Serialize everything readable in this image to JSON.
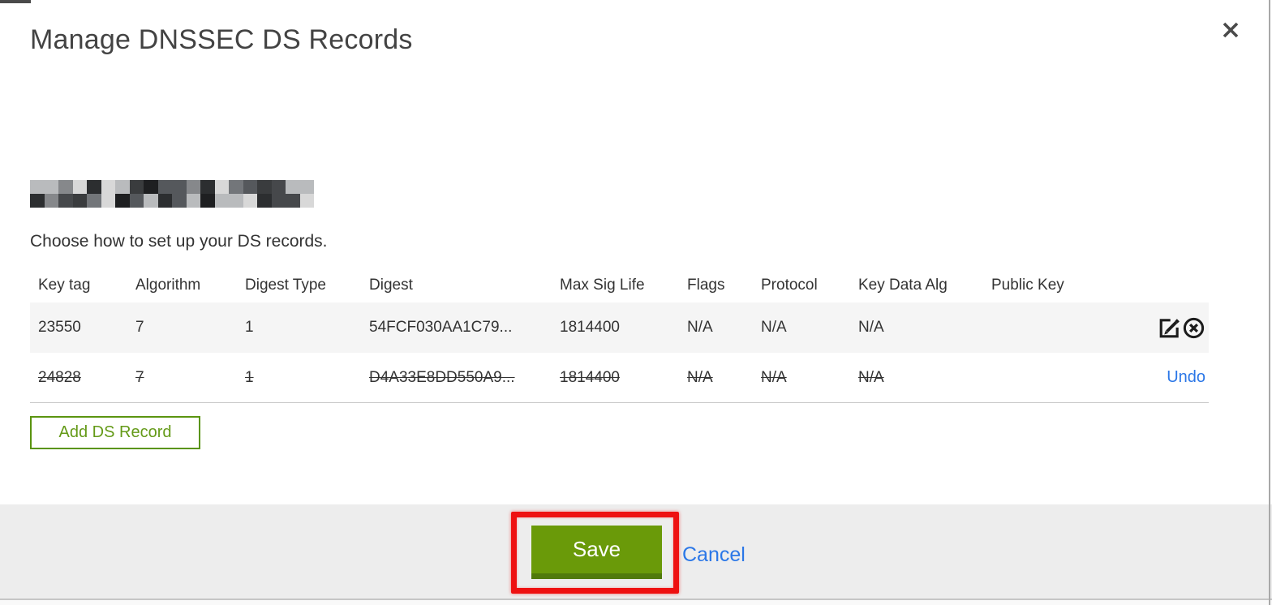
{
  "dialog": {
    "title": "Manage DNSSEC DS Records",
    "subtitle": "Choose how to set up your DS records."
  },
  "colors": {
    "save_button_green": "#6a9a09",
    "save_button_border": "#507a0b",
    "add_button_green": "#5a9410",
    "link_blue": "#2b77e7",
    "annotation_red": "#ee1111",
    "row_highlight_bg": "#f5f5f5",
    "footer_bg": "#ededed"
  },
  "redaction": {
    "palette": [
      "#1e1f21",
      "#3a3c3e",
      "#55585c",
      "#73767a",
      "#97999c",
      "#b9bbbd",
      "#d8d8d8",
      "#2c2e30",
      "#46484b",
      "#86888b"
    ]
  },
  "table": {
    "columns": [
      "Key tag",
      "Algorithm",
      "Digest Type",
      "Digest",
      "Max Sig Life",
      "Flags",
      "Protocol",
      "Key Data Alg",
      "Public Key"
    ],
    "rows": [
      {
        "key_tag": "23550",
        "algorithm": "7",
        "digest_type": "1",
        "digest": "54FCF030AA1C79...",
        "max_sig_life": "1814400",
        "flags": "N/A",
        "protocol": "N/A",
        "key_data_alg": "N/A",
        "public_key": "",
        "deleted": false
      },
      {
        "key_tag": "24828",
        "algorithm": "7",
        "digest_type": "1",
        "digest": "D4A33E8DD550A9...",
        "max_sig_life": "1814400",
        "flags": "N/A",
        "protocol": "N/A",
        "key_data_alg": "N/A",
        "public_key": "",
        "deleted": true,
        "action_label": "Undo"
      }
    ]
  },
  "buttons": {
    "add_ds_record": "Add DS Record",
    "save": "Save",
    "cancel": "Cancel"
  }
}
